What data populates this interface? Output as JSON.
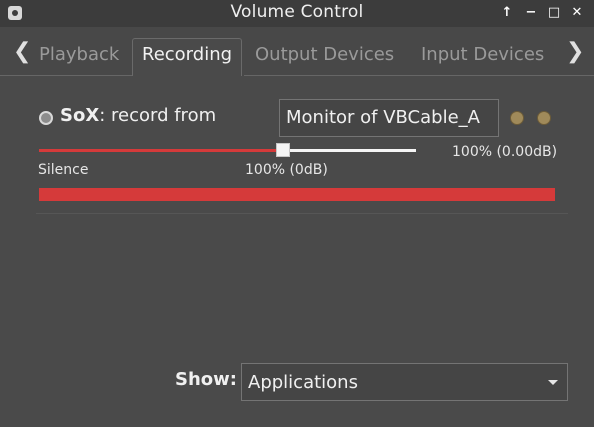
{
  "window": {
    "title": "Volume Control",
    "icon": "app-icon",
    "controls": {
      "pin": "↑",
      "minimize": "−",
      "maximize": "□",
      "close": "✕"
    }
  },
  "tabs": {
    "scroll_left": "❮",
    "scroll_right": "❯",
    "items": [
      {
        "label": "Playback",
        "active": false
      },
      {
        "label": "Recording",
        "active": true
      },
      {
        "label": "Output Devices",
        "active": false
      },
      {
        "label": "Input Devices",
        "active": false
      }
    ]
  },
  "stream": {
    "app_name": "SoX",
    "action": ": record from",
    "device": "Monitor of VBCable_A",
    "volume_percent": 100,
    "volume_text": "100% (0.00dB)",
    "slider_labels": {
      "min": "Silence",
      "mark": "100% (0dB)"
    },
    "level_meter": 1.0
  },
  "footer": {
    "show_label": "Show:",
    "show_value": "Applications"
  },
  "colors": {
    "accent": "#d53a3a",
    "background": "#4a4a4a"
  }
}
